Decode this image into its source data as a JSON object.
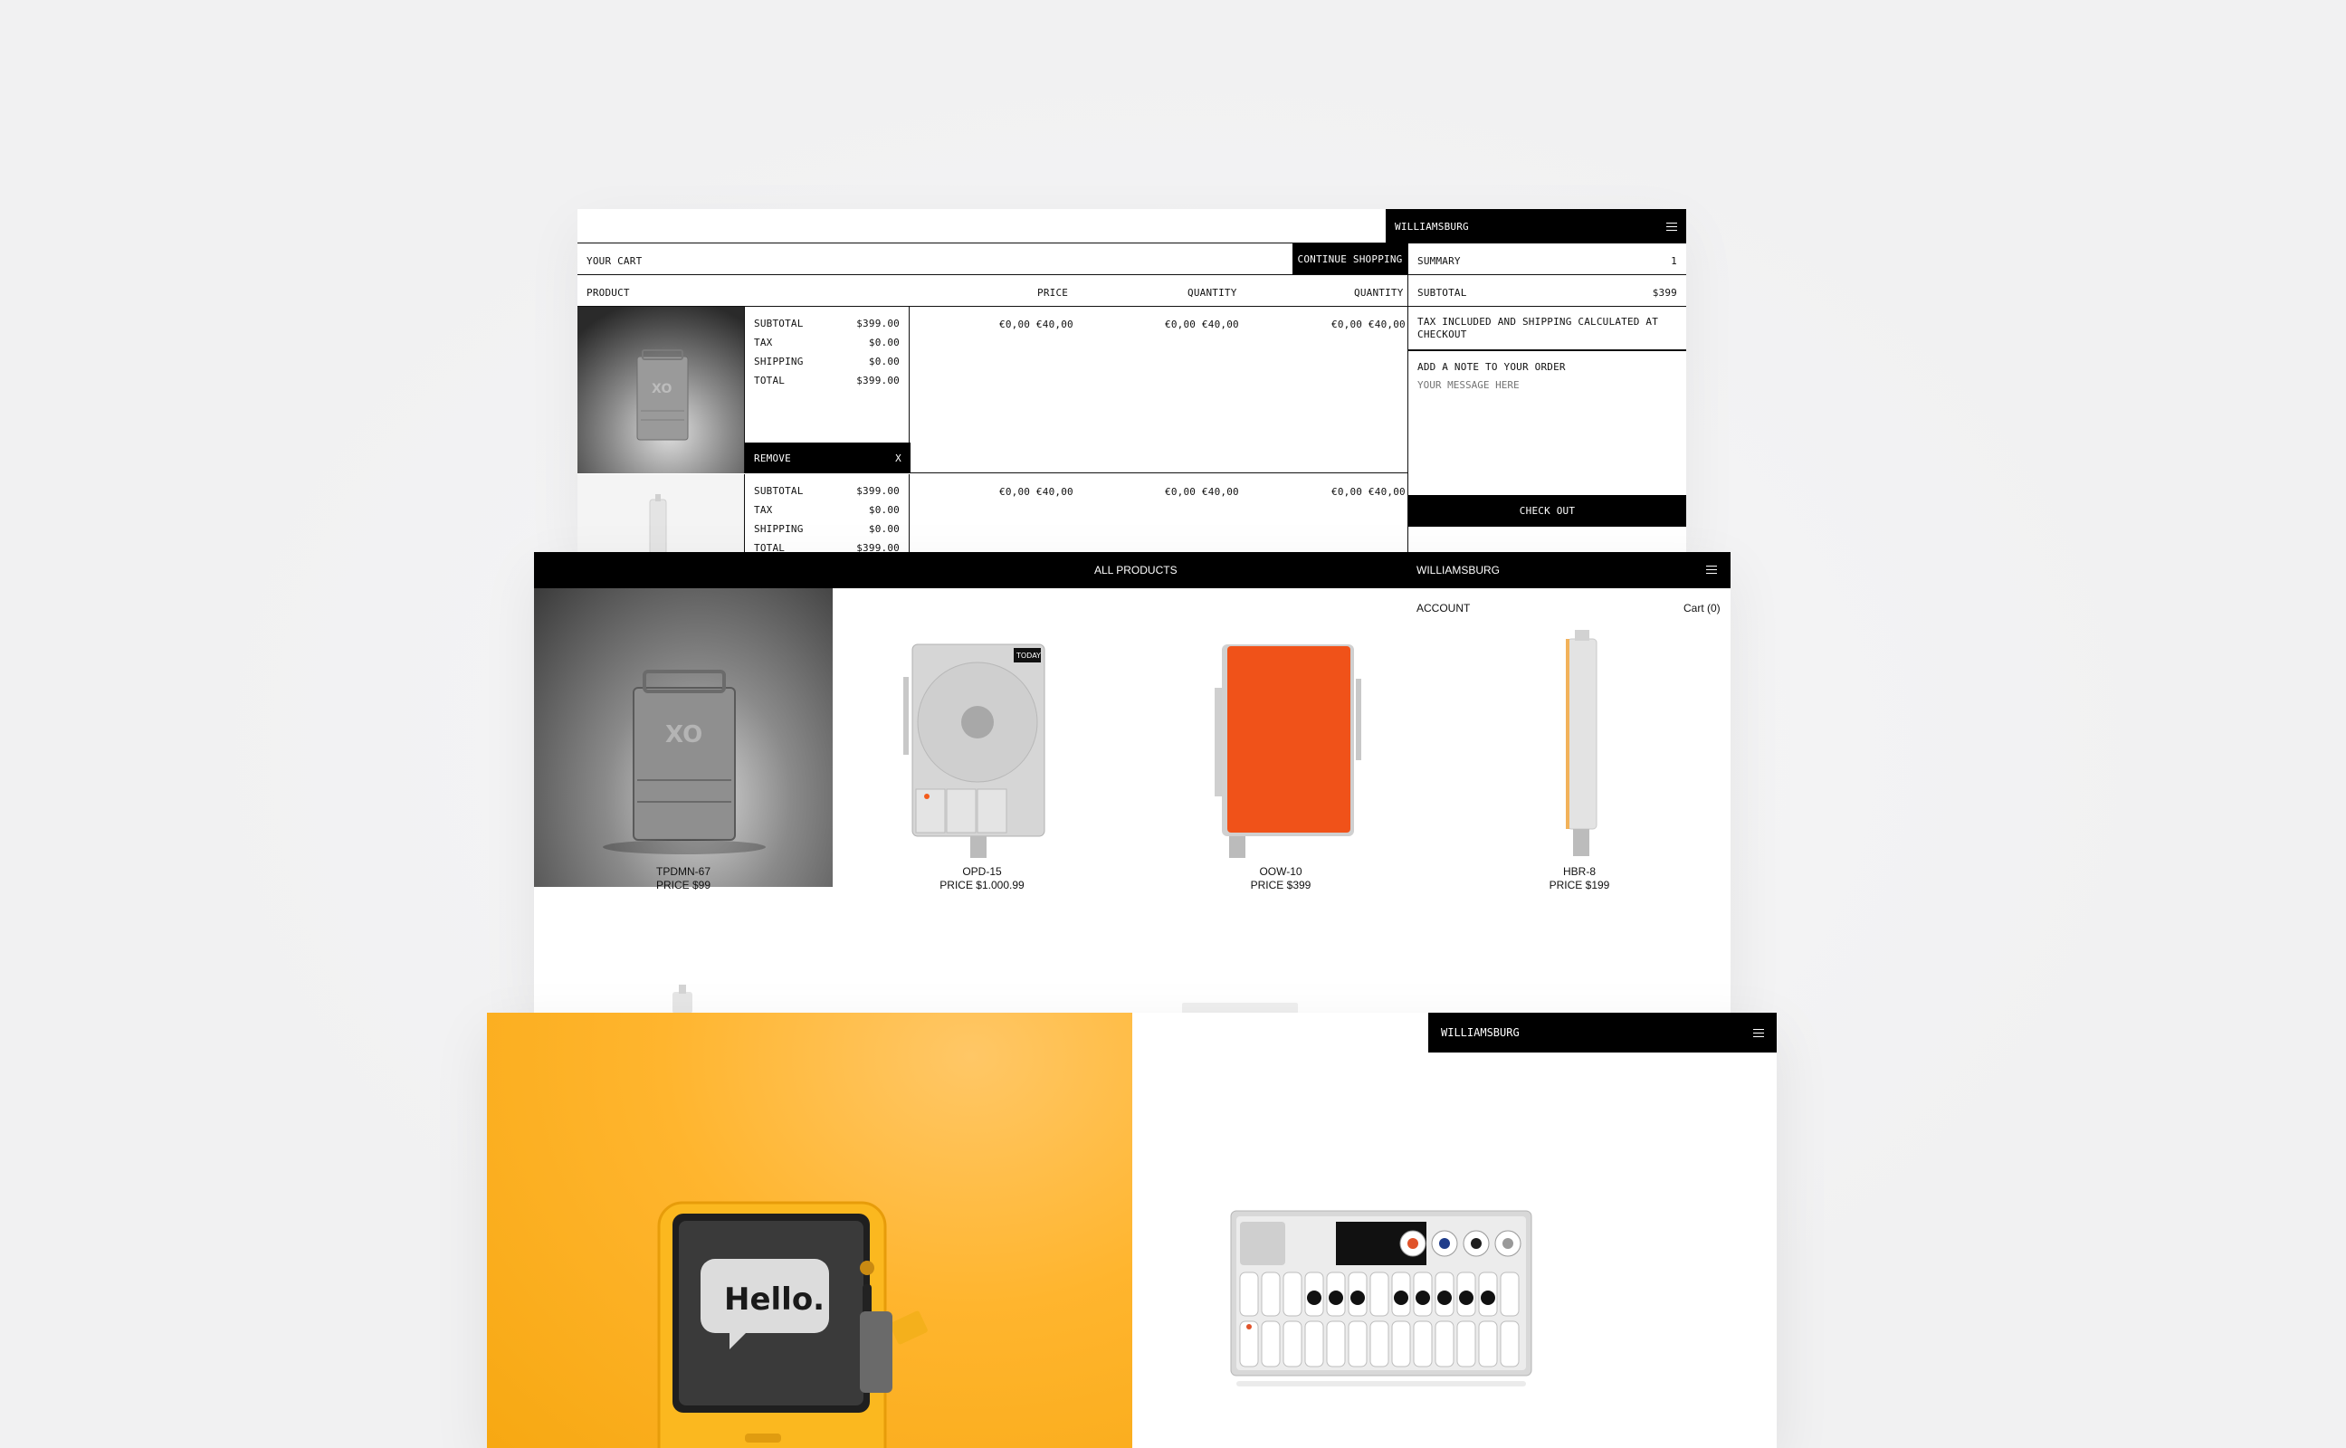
{
  "cart": {
    "location": "WILLIAMSBURG",
    "title": "YOUR CART",
    "continue_label": "CONTINUE SHOPPING",
    "columns": {
      "product": "PRODUCT",
      "price": "PRICE",
      "quantity": "QUANTITY",
      "quantity2": "QUANTITY"
    },
    "items": [
      {
        "subtotal_label": "SUBTOTAL",
        "subtotal": "$399.00",
        "tax_label": "TAX",
        "tax": "$0.00",
        "shipping_label": "SHIPPING",
        "shipping": "$0.00",
        "total_label": "TOTAL",
        "total": "$399.00",
        "price": "€0,00 €40,00",
        "quantity": "€0,00 €40,00",
        "quantity2": "€0,00 €40,00",
        "remove_label": "REMOVE",
        "remove_x": "X"
      },
      {
        "subtotal_label": "SUBTOTAL",
        "subtotal": "$399.00",
        "tax_label": "TAX",
        "tax": "$0.00",
        "shipping_label": "SHIPPING",
        "shipping": "$0.00",
        "total_label": "TOTAL",
        "total": "$399.00",
        "price": "€0,00 €40,00",
        "quantity": "€0,00 €40,00",
        "quantity2": "€0,00 €40,00"
      }
    ],
    "summary": {
      "title": "SUMMARY",
      "count": "1",
      "subtotal_label": "SUBTOTAL",
      "subtotal": "$399",
      "tax_note": "TAX INCLUDED AND SHIPPING CALCULATED AT CHECKOUT",
      "note_label": "ADD A NOTE TO YOUR ORDER",
      "note_placeholder": "YOUR MESSAGE HERE",
      "checkout_label": "CHECK OUT"
    }
  },
  "products": {
    "nav_all": "ALL PRODUCTS",
    "location": "WILLIAMSBURG",
    "account": "ACCOUNT",
    "cart": "Cart (0)",
    "items": [
      {
        "name": "TPDMN-67",
        "price": "PRICE $99"
      },
      {
        "name": "OPD-15",
        "price": "PRICE $1.000.99"
      },
      {
        "name": "OOW-10",
        "price": "PRICE $399"
      },
      {
        "name": "HBR-8",
        "price": "PRICE $199"
      }
    ]
  },
  "feature": {
    "location": "WILLIAMSBURG",
    "device_screen_text": "Hello."
  }
}
